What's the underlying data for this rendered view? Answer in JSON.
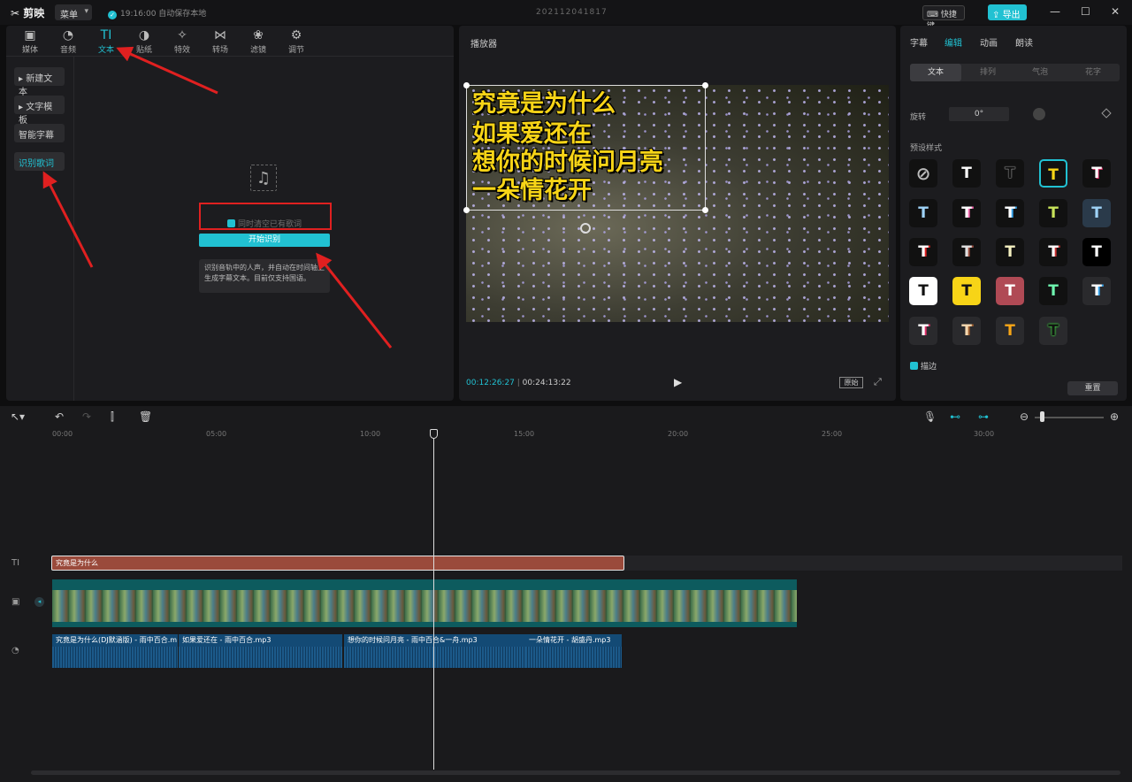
{
  "titlebar": {
    "app_name": "剪映",
    "menu_label": "菜单",
    "save_status": "19:16:00 自动保存本地",
    "project_name": "202112041817",
    "shortcut_label": "快捷键",
    "export_label": "导出"
  },
  "media_tabs": [
    {
      "label": "媒体",
      "icon": "media-icon"
    },
    {
      "label": "音频",
      "icon": "audio-icon"
    },
    {
      "label": "文本",
      "icon": "text-icon",
      "active": true
    },
    {
      "label": "贴纸",
      "icon": "sticker-icon"
    },
    {
      "label": "特效",
      "icon": "effects-icon"
    },
    {
      "label": "转场",
      "icon": "transition-icon"
    },
    {
      "label": "滤镜",
      "icon": "filter-icon"
    },
    {
      "label": "调节",
      "icon": "adjust-icon"
    }
  ],
  "text_sidebar": [
    {
      "label": "新建文本"
    },
    {
      "label": "文字模板"
    },
    {
      "label": "智能字幕"
    },
    {
      "label": "识别歌词",
      "active": true
    }
  ],
  "lyrics": {
    "clear_option": "同时清空已有歌词",
    "start_button": "开始识别",
    "hint": "识别音轨中的人声，并自动在时间轴上生成字幕文本。目前仅支持国语。"
  },
  "player": {
    "title": "播放器",
    "subtitle_lines": [
      "究竟是为什么",
      "如果爱还在",
      "想你的时候问月亮",
      "一朵情花开"
    ],
    "current_time": "00:12:26:27",
    "total_time": "00:24:13:22",
    "ratio_label": "原始"
  },
  "inspector": {
    "tabs": [
      "字幕",
      "编辑",
      "动画",
      "朗读"
    ],
    "active_tab": "编辑",
    "sub_tabs": [
      "文本",
      "排列",
      "气泡",
      "花字"
    ],
    "rotate_label": "旋转",
    "rotate_value": "0°",
    "preset_label": "预设样式",
    "stroke_label": "描边",
    "reset_label": "重置"
  },
  "timeline": {
    "ruler": [
      "00:00",
      "05:00",
      "10:00",
      "15:00",
      "20:00",
      "25:00",
      "30:00"
    ],
    "text_clip": "究竟是为什么",
    "audio_clips": [
      "究竟是为什么(DJ默涵版) - 雨中百合.m",
      "如果爱还在 - 雨中百合.mp3",
      "想你的时候问月亮 - 雨中百合&一舟.mp3",
      "一朵情花开 - 胡盛丹.mp3"
    ]
  },
  "colors": {
    "accent": "#21c1d2",
    "text_clip": "#9a4a3b",
    "annotation": "#e02020",
    "subtitle": "#f7d417"
  }
}
